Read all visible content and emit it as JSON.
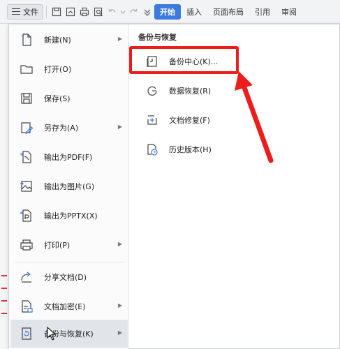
{
  "toolbar": {
    "file_label": "文件",
    "tabs": [
      {
        "label": "开始",
        "active": true
      },
      {
        "label": "插入"
      },
      {
        "label": "页面布局"
      },
      {
        "label": "引用"
      },
      {
        "label": "审阅"
      }
    ]
  },
  "menu": {
    "items": [
      {
        "label": "新建(N)",
        "icon": "new-doc-icon",
        "has_submenu": true
      },
      {
        "label": "打开(O)",
        "icon": "folder-icon",
        "has_submenu": false
      },
      {
        "label": "保存(S)",
        "icon": "save-icon",
        "has_submenu": false
      },
      {
        "label": "另存为(A)",
        "icon": "save-as-icon",
        "has_submenu": true
      },
      {
        "label": "输出为PDF(F)",
        "icon": "export-pdf-icon",
        "has_submenu": false
      },
      {
        "label": "输出为图片(G)",
        "icon": "export-image-icon",
        "has_submenu": false
      },
      {
        "label": "输出为PPTX(X)",
        "icon": "export-pptx-icon",
        "has_submenu": false
      },
      {
        "label": "打印(P)",
        "icon": "print-icon",
        "has_submenu": true
      },
      {
        "label": "分享文档(D)",
        "icon": "share-icon",
        "has_submenu": false
      },
      {
        "label": "文档加密(E)",
        "icon": "encrypt-icon",
        "has_submenu": true
      },
      {
        "label": "备份与恢复(K)",
        "icon": "backup-restore-icon",
        "has_submenu": true,
        "selected": true
      }
    ],
    "submenu": {
      "title": "备份与恢复",
      "items": [
        {
          "label": "备份中心(K)...",
          "icon": "backup-center-icon",
          "highlighted": true
        },
        {
          "label": "数据恢复(R)",
          "icon": "data-recovery-icon"
        },
        {
          "label": "文档修复(F)",
          "icon": "doc-repair-icon"
        },
        {
          "label": "历史版本(H)",
          "icon": "history-version-icon"
        }
      ]
    }
  },
  "colors": {
    "accent": "#3b7bde",
    "highlight": "#ee1d1d",
    "selected_bg": "#e1e4e9"
  }
}
